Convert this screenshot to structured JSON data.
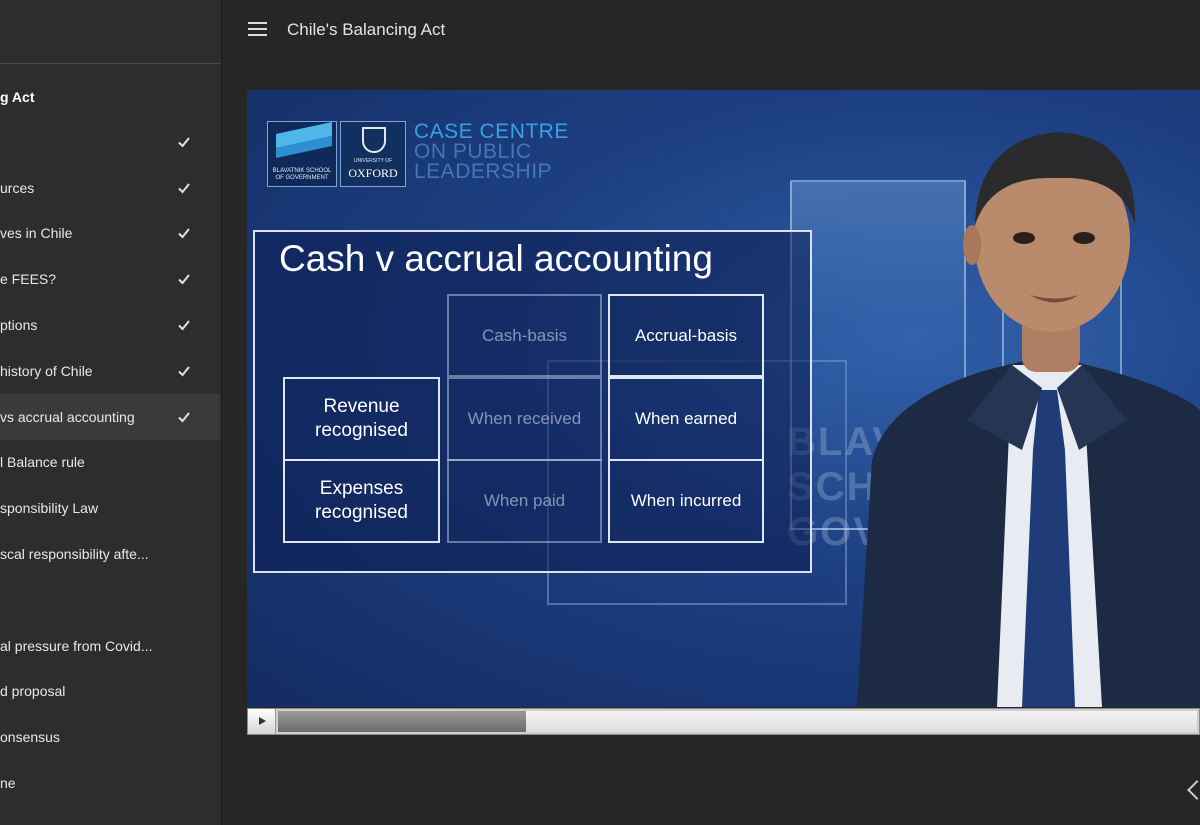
{
  "header": {
    "title": "Chile's Balancing Act"
  },
  "sidebar": {
    "course_title": "g Act",
    "items": [
      {
        "label": "",
        "completed": true
      },
      {
        "label": "urces",
        "completed": true
      },
      {
        "label": "ves in Chile",
        "completed": true
      },
      {
        "label": "e FEES?",
        "completed": true
      },
      {
        "label": "ptions",
        "completed": true
      },
      {
        "label": "history of Chile",
        "completed": true
      },
      {
        "label": "vs accrual accounting",
        "completed": true,
        "active": true
      },
      {
        "label": "l Balance rule",
        "completed": false
      },
      {
        "label": "sponsibility Law",
        "completed": false
      },
      {
        "label": "scal responsibility afte...",
        "completed": false
      },
      {
        "label": "",
        "completed": false
      },
      {
        "label": "al pressure from Covid...",
        "completed": false
      },
      {
        "label": "d proposal",
        "completed": false
      },
      {
        "label": "onsensus",
        "completed": false
      },
      {
        "label": "ne",
        "completed": false
      }
    ]
  },
  "video": {
    "logos": {
      "bsg": "BLAVATNIK SCHOOL OF GOVERNMENT",
      "oxford_small": "UNIVERSITY OF",
      "oxford": "OXFORD",
      "centre": [
        "CASE CENTRE",
        "ON PUBLIC",
        "LEADERSHIP"
      ]
    },
    "background_words": [
      "BLAVATN",
      "SCHOOL",
      "GOVERNM"
    ],
    "slide": {
      "title": "Cash v accrual accounting",
      "col_headers": [
        "Cash-basis",
        "Accrual-basis"
      ],
      "rows": [
        {
          "label": [
            "Revenue",
            "recognised"
          ],
          "cash": "When received",
          "accrual": "When earned"
        },
        {
          "label": [
            "Expenses",
            "recognised"
          ],
          "cash": "When paid",
          "accrual": "When incurred"
        }
      ]
    },
    "progress": 0.27
  },
  "colors": {
    "background": "#262626",
    "sidebar": "#2d2d2d",
    "video_blue": "#1d3f82",
    "accent_blue": "#3aa0e0"
  },
  "icons": {
    "menu": "hamburger-icon",
    "check": "checkmark-icon",
    "play": "play-icon",
    "next": "chevron-left-icon"
  }
}
